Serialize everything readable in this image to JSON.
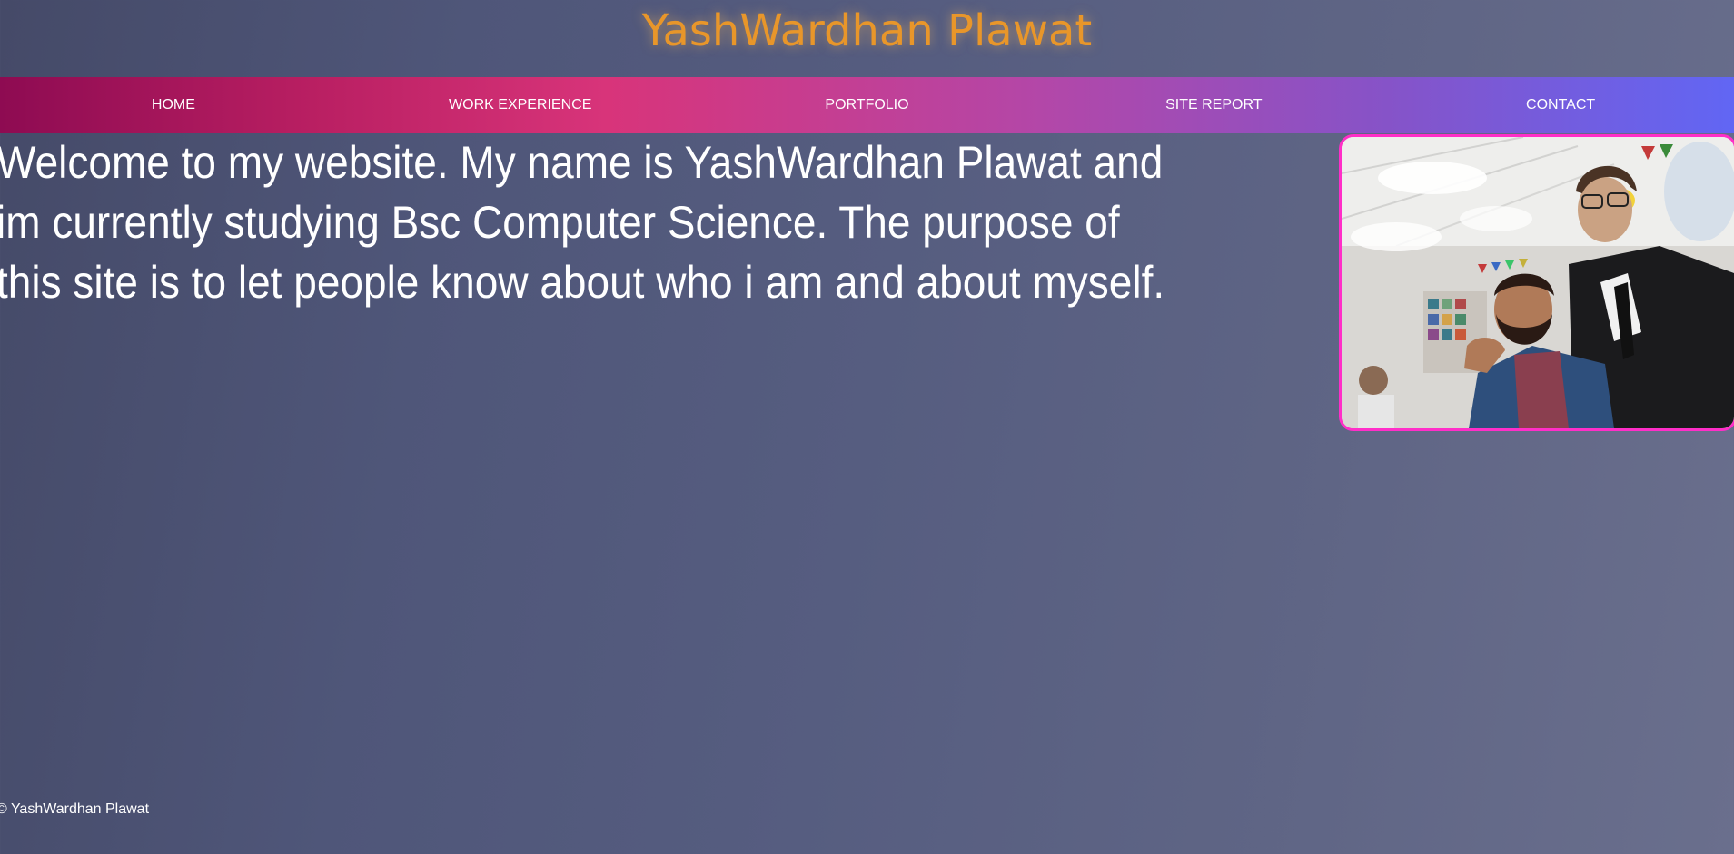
{
  "header": {
    "title": "YashWardhan Plawat",
    "title_color": "#e8962a"
  },
  "nav": {
    "items": [
      {
        "label": "HOME"
      },
      {
        "label": "WORK EXPERIENCE"
      },
      {
        "label": "PORTFOLIO"
      },
      {
        "label": "SITE REPORT"
      },
      {
        "label": "CONTACT"
      }
    ]
  },
  "main": {
    "intro": "Welcome to my website. My name is YashWardhan Plawat and im currently studying Bsc Computer Science. The purpose of this site is to let people know about who i am and about myself.",
    "photo_icon": "profile-photo"
  },
  "footer": {
    "copyright": "© YashWardhan Plawat"
  },
  "colors": {
    "nav_start": "#8e0b52",
    "nav_mid": "#d8347a",
    "nav_end": "#6166f4",
    "photo_border": "#ff2ec8"
  }
}
